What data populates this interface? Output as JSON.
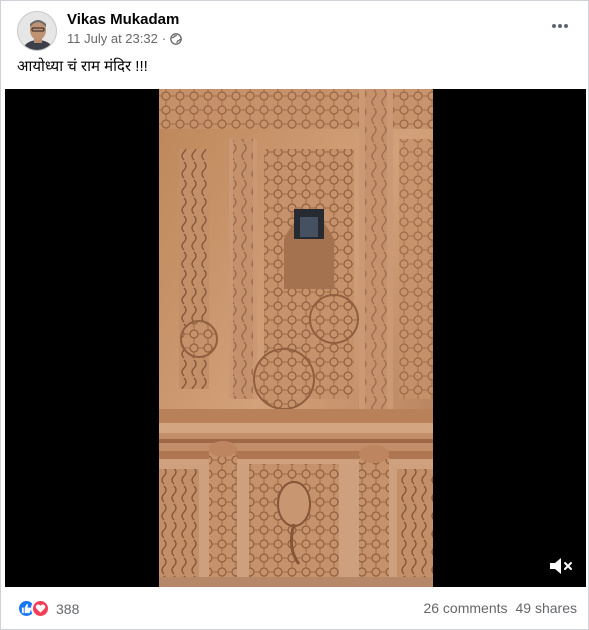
{
  "post": {
    "author": "Vikas Mukadam",
    "timestamp": "11 July at 23:32",
    "privacy_icon": "globe-icon",
    "caption": "आयोध्या चं राम मंदिर !!!"
  },
  "video": {
    "content": "carved sandstone temple",
    "mute_icon": "speaker-muted-icon"
  },
  "engagement": {
    "reactions": [
      "like",
      "love"
    ],
    "reaction_count": "388",
    "comments": "26 comments",
    "shares": "49 shares"
  },
  "colors": {
    "like": "#1877f2",
    "love": "#f33e58",
    "secondary_text": "#65676b",
    "stone": "#d9a57c"
  }
}
